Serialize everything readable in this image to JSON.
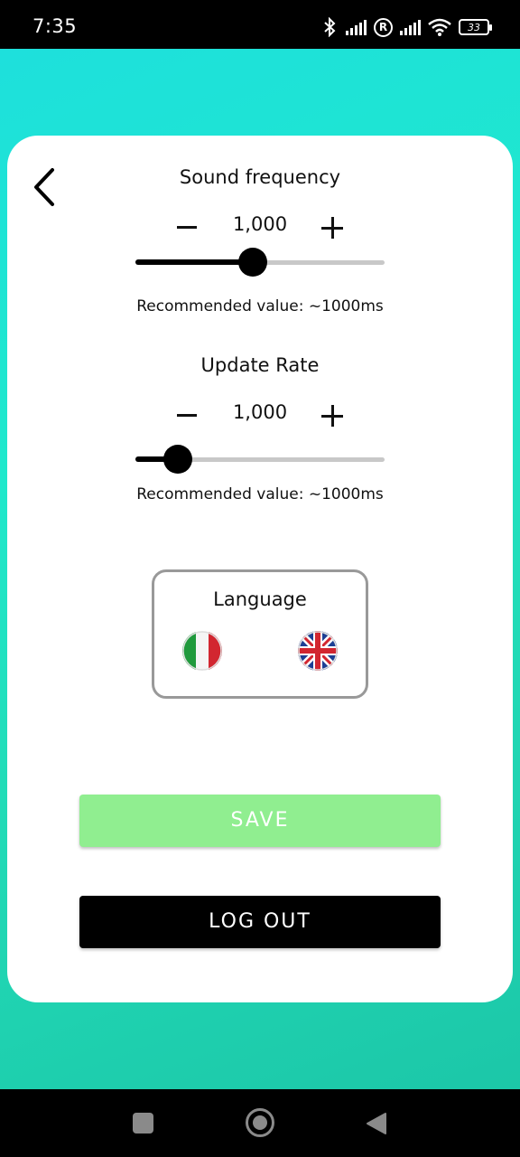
{
  "status_bar": {
    "time": "7:35",
    "battery": "33",
    "icons": [
      "bluetooth-icon",
      "signal-icon",
      "registered-icon",
      "signal-icon",
      "wifi-icon",
      "battery-icon"
    ]
  },
  "settings": {
    "sound_frequency": {
      "title": "Sound frequency",
      "value": "1,000",
      "slider_fraction": 0.47,
      "hint": "Recommended value: ~1000ms"
    },
    "update_rate": {
      "title": "Update Rate",
      "value": "1,000",
      "slider_fraction": 0.17,
      "hint": "Recommended value: ~1000ms"
    },
    "language": {
      "title": "Language",
      "options": [
        "italian-flag-icon",
        "uk-flag-icon"
      ]
    }
  },
  "buttons": {
    "save_label": "SAVE",
    "logout_label": "LOG OUT"
  },
  "colors": {
    "save_button": "#90ee90",
    "logout_button": "#000000",
    "background_gradient_start": "#1ee0dc",
    "background_gradient_end": "#1cc7a8"
  }
}
